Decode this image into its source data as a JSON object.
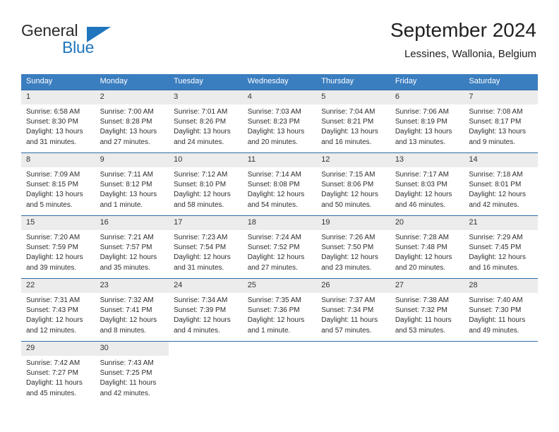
{
  "brand": {
    "name_part1": "General",
    "name_part2": "Blue",
    "logo_icon": "triangle-logo-icon"
  },
  "header": {
    "title": "September 2024",
    "subtitle": "Lessines, Wallonia, Belgium"
  },
  "colors": {
    "header_blue": "#3b7ec0",
    "row_border_blue": "#2f6ca8",
    "daynum_background": "#ececec",
    "brand_blue": "#1f76bd",
    "text": "#2d2d2d"
  },
  "weekdays": [
    "Sunday",
    "Monday",
    "Tuesday",
    "Wednesday",
    "Thursday",
    "Friday",
    "Saturday"
  ],
  "weeks": [
    [
      {
        "day": "1",
        "sunrise": "Sunrise: 6:58 AM",
        "sunset": "Sunset: 8:30 PM",
        "daylight": "Daylight: 13 hours and 31 minutes."
      },
      {
        "day": "2",
        "sunrise": "Sunrise: 7:00 AM",
        "sunset": "Sunset: 8:28 PM",
        "daylight": "Daylight: 13 hours and 27 minutes."
      },
      {
        "day": "3",
        "sunrise": "Sunrise: 7:01 AM",
        "sunset": "Sunset: 8:26 PM",
        "daylight": "Daylight: 13 hours and 24 minutes."
      },
      {
        "day": "4",
        "sunrise": "Sunrise: 7:03 AM",
        "sunset": "Sunset: 8:23 PM",
        "daylight": "Daylight: 13 hours and 20 minutes."
      },
      {
        "day": "5",
        "sunrise": "Sunrise: 7:04 AM",
        "sunset": "Sunset: 8:21 PM",
        "daylight": "Daylight: 13 hours and 16 minutes."
      },
      {
        "day": "6",
        "sunrise": "Sunrise: 7:06 AM",
        "sunset": "Sunset: 8:19 PM",
        "daylight": "Daylight: 13 hours and 13 minutes."
      },
      {
        "day": "7",
        "sunrise": "Sunrise: 7:08 AM",
        "sunset": "Sunset: 8:17 PM",
        "daylight": "Daylight: 13 hours and 9 minutes."
      }
    ],
    [
      {
        "day": "8",
        "sunrise": "Sunrise: 7:09 AM",
        "sunset": "Sunset: 8:15 PM",
        "daylight": "Daylight: 13 hours and 5 minutes."
      },
      {
        "day": "9",
        "sunrise": "Sunrise: 7:11 AM",
        "sunset": "Sunset: 8:12 PM",
        "daylight": "Daylight: 13 hours and 1 minute."
      },
      {
        "day": "10",
        "sunrise": "Sunrise: 7:12 AM",
        "sunset": "Sunset: 8:10 PM",
        "daylight": "Daylight: 12 hours and 58 minutes."
      },
      {
        "day": "11",
        "sunrise": "Sunrise: 7:14 AM",
        "sunset": "Sunset: 8:08 PM",
        "daylight": "Daylight: 12 hours and 54 minutes."
      },
      {
        "day": "12",
        "sunrise": "Sunrise: 7:15 AM",
        "sunset": "Sunset: 8:06 PM",
        "daylight": "Daylight: 12 hours and 50 minutes."
      },
      {
        "day": "13",
        "sunrise": "Sunrise: 7:17 AM",
        "sunset": "Sunset: 8:03 PM",
        "daylight": "Daylight: 12 hours and 46 minutes."
      },
      {
        "day": "14",
        "sunrise": "Sunrise: 7:18 AM",
        "sunset": "Sunset: 8:01 PM",
        "daylight": "Daylight: 12 hours and 42 minutes."
      }
    ],
    [
      {
        "day": "15",
        "sunrise": "Sunrise: 7:20 AM",
        "sunset": "Sunset: 7:59 PM",
        "daylight": "Daylight: 12 hours and 39 minutes."
      },
      {
        "day": "16",
        "sunrise": "Sunrise: 7:21 AM",
        "sunset": "Sunset: 7:57 PM",
        "daylight": "Daylight: 12 hours and 35 minutes."
      },
      {
        "day": "17",
        "sunrise": "Sunrise: 7:23 AM",
        "sunset": "Sunset: 7:54 PM",
        "daylight": "Daylight: 12 hours and 31 minutes."
      },
      {
        "day": "18",
        "sunrise": "Sunrise: 7:24 AM",
        "sunset": "Sunset: 7:52 PM",
        "daylight": "Daylight: 12 hours and 27 minutes."
      },
      {
        "day": "19",
        "sunrise": "Sunrise: 7:26 AM",
        "sunset": "Sunset: 7:50 PM",
        "daylight": "Daylight: 12 hours and 23 minutes."
      },
      {
        "day": "20",
        "sunrise": "Sunrise: 7:28 AM",
        "sunset": "Sunset: 7:48 PM",
        "daylight": "Daylight: 12 hours and 20 minutes."
      },
      {
        "day": "21",
        "sunrise": "Sunrise: 7:29 AM",
        "sunset": "Sunset: 7:45 PM",
        "daylight": "Daylight: 12 hours and 16 minutes."
      }
    ],
    [
      {
        "day": "22",
        "sunrise": "Sunrise: 7:31 AM",
        "sunset": "Sunset: 7:43 PM",
        "daylight": "Daylight: 12 hours and 12 minutes."
      },
      {
        "day": "23",
        "sunrise": "Sunrise: 7:32 AM",
        "sunset": "Sunset: 7:41 PM",
        "daylight": "Daylight: 12 hours and 8 minutes."
      },
      {
        "day": "24",
        "sunrise": "Sunrise: 7:34 AM",
        "sunset": "Sunset: 7:39 PM",
        "daylight": "Daylight: 12 hours and 4 minutes."
      },
      {
        "day": "25",
        "sunrise": "Sunrise: 7:35 AM",
        "sunset": "Sunset: 7:36 PM",
        "daylight": "Daylight: 12 hours and 1 minute."
      },
      {
        "day": "26",
        "sunrise": "Sunrise: 7:37 AM",
        "sunset": "Sunset: 7:34 PM",
        "daylight": "Daylight: 11 hours and 57 minutes."
      },
      {
        "day": "27",
        "sunrise": "Sunrise: 7:38 AM",
        "sunset": "Sunset: 7:32 PM",
        "daylight": "Daylight: 11 hours and 53 minutes."
      },
      {
        "day": "28",
        "sunrise": "Sunrise: 7:40 AM",
        "sunset": "Sunset: 7:30 PM",
        "daylight": "Daylight: 11 hours and 49 minutes."
      }
    ],
    [
      {
        "day": "29",
        "sunrise": "Sunrise: 7:42 AM",
        "sunset": "Sunset: 7:27 PM",
        "daylight": "Daylight: 11 hours and 45 minutes."
      },
      {
        "day": "30",
        "sunrise": "Sunrise: 7:43 AM",
        "sunset": "Sunset: 7:25 PM",
        "daylight": "Daylight: 11 hours and 42 minutes."
      },
      {
        "day": "",
        "sunrise": "",
        "sunset": "",
        "daylight": ""
      },
      {
        "day": "",
        "sunrise": "",
        "sunset": "",
        "daylight": ""
      },
      {
        "day": "",
        "sunrise": "",
        "sunset": "",
        "daylight": ""
      },
      {
        "day": "",
        "sunrise": "",
        "sunset": "",
        "daylight": ""
      },
      {
        "day": "",
        "sunrise": "",
        "sunset": "",
        "daylight": ""
      }
    ]
  ]
}
